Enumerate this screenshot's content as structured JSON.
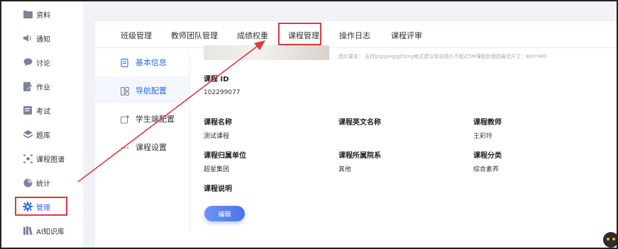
{
  "sidebar": {
    "items": [
      {
        "label": "资料",
        "icon": "folder-icon"
      },
      {
        "label": "通知",
        "icon": "speaker-icon"
      },
      {
        "label": "讨论",
        "icon": "chat-bubble-icon"
      },
      {
        "label": "作业",
        "icon": "pencil-doc-icon"
      },
      {
        "label": "考试",
        "icon": "exam-doc-icon"
      },
      {
        "label": "题库",
        "icon": "layers-icon"
      },
      {
        "label": "课程图谱",
        "icon": "graph-nodes-icon"
      },
      {
        "label": "统计",
        "icon": "pie-chart-icon"
      },
      {
        "label": "管理",
        "icon": "gear-icon",
        "active": true
      },
      {
        "label": "AI知识库",
        "icon": "books-icon"
      }
    ]
  },
  "tabs": [
    {
      "label": "班级管理"
    },
    {
      "label": "教师团队管理"
    },
    {
      "label": "成绩权重"
    },
    {
      "label": "课程管理",
      "active": true
    },
    {
      "label": "操作日志"
    },
    {
      "label": "课程评审"
    }
  ],
  "submenu": [
    {
      "label": "基本信息",
      "icon": "doc-icon"
    },
    {
      "label": "导航配置",
      "icon": "layout-icon",
      "active": true
    },
    {
      "label": "学生端配置",
      "icon": "screen-icon"
    },
    {
      "label": "课程设置",
      "icon": "dots-icon"
    }
  ],
  "cover_hint": "图片要求：  支持jpg/jpeg/gif/png格式建议单张图片不超过5M课程封面图最佳尺寸：800*480",
  "fields": {
    "course_id": {
      "label": "课程 ID",
      "value": "102299077"
    },
    "course_name": {
      "label": "课程名称",
      "value": "测试课程"
    },
    "course_en_name": {
      "label": "课程英文名称",
      "value": ""
    },
    "teacher": {
      "label": "课程教师",
      "value": "王彩玲"
    },
    "unit": {
      "label": "课程归属单位",
      "value": "超星集团"
    },
    "department": {
      "label": "课程所属院系",
      "value": "其他"
    },
    "category": {
      "label": "课程分类",
      "value": "综合素养"
    },
    "description": {
      "label": "课程说明",
      "value": ""
    }
  },
  "edit_label": "编辑",
  "colors": {
    "accent": "#2f6de9",
    "highlight_red": "#e0383e",
    "content_bg": "#f1f2f5"
  }
}
